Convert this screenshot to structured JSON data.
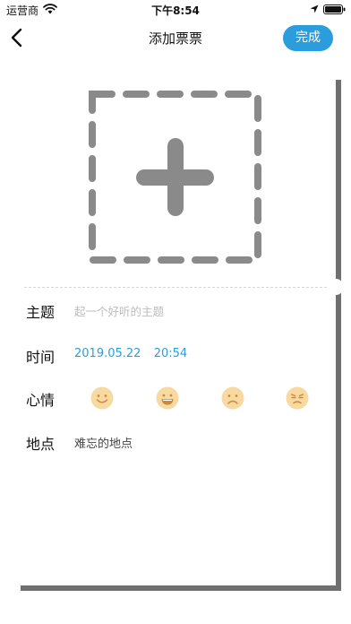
{
  "status_bar": {
    "carrier": "运营商",
    "time": "下午8:54",
    "icons": [
      "wifi-icon",
      "location-arrow-icon",
      "battery-icon"
    ]
  },
  "nav": {
    "back_icon": "chevron-left-icon",
    "title": "添加票票",
    "done_label": "完成"
  },
  "ticket": {
    "add_photo_icon": "dashed-plus-icon",
    "subject": {
      "label": "主题",
      "value": "",
      "placeholder": "起一个好听的主题"
    },
    "time": {
      "label": "时间",
      "date": "2019.05.22",
      "clock": "20:54"
    },
    "mood": {
      "label": "心情",
      "options": [
        "happy-face-icon",
        "grin-face-icon",
        "sad-face-icon",
        "annoyed-face-icon"
      ]
    },
    "place": {
      "label": "地点",
      "value": "难忘的地点"
    }
  },
  "colors": {
    "accent": "#2b9ddd",
    "placeholder": "#bdbdbd",
    "dashed_frame": "#8a8a8a",
    "mood_face": "#f8d9a2",
    "mood_feature": "#c98a3c",
    "card_shadow": "#6f6f6f"
  }
}
